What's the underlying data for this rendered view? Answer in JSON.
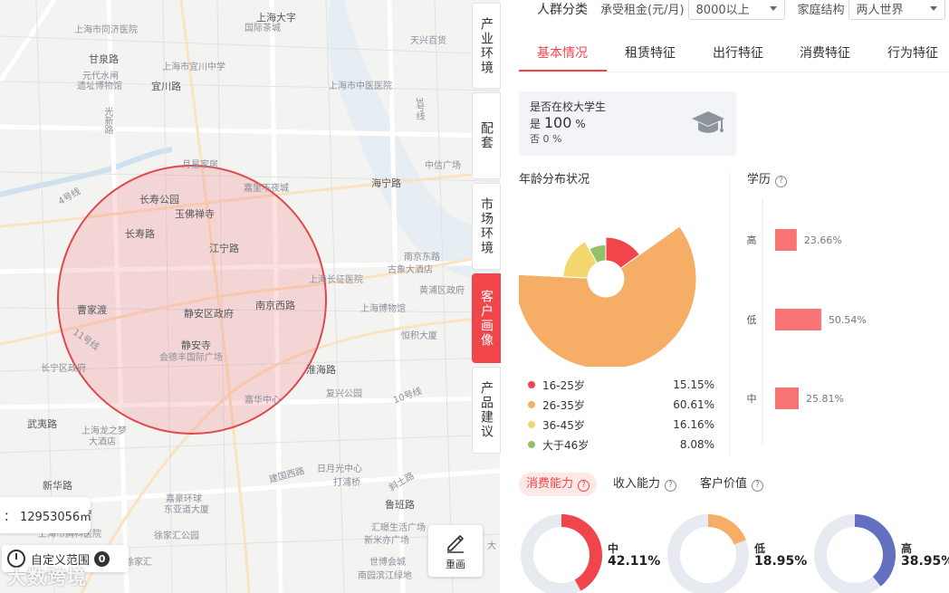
{
  "map": {
    "labels": [
      {
        "text": "上海大字",
        "cls": "dark"
      },
      {
        "text": "国际茶城",
        "cls": ""
      },
      {
        "text": "上海市同济医院",
        "cls": ""
      },
      {
        "text": "天兴百货",
        "cls": ""
      },
      {
        "text": "甘泉路",
        "cls": "dark"
      },
      {
        "text": "上海市宜川中学",
        "cls": ""
      },
      {
        "text": "元代水闸",
        "cls": ""
      },
      {
        "text": "遗址博物馆",
        "cls": ""
      },
      {
        "text": "宜川路",
        "cls": "dark"
      },
      {
        "text": "上海市中医医院",
        "cls": ""
      },
      {
        "text": "光新路",
        "cls": ""
      },
      {
        "text": "3号线",
        "cls": ""
      },
      {
        "text": "中信广场",
        "cls": ""
      },
      {
        "text": "月星家居",
        "cls": ""
      },
      {
        "text": "嘉里不夜城",
        "cls": ""
      },
      {
        "text": "海宁路",
        "cls": "dark"
      },
      {
        "text": "4号线",
        "cls": ""
      },
      {
        "text": "长寿公园",
        "cls": "dark"
      },
      {
        "text": "玉佛禅寺",
        "cls": "dark"
      },
      {
        "text": "长寿路",
        "cls": "dark"
      },
      {
        "text": "江宁路",
        "cls": "dark"
      },
      {
        "text": "南京东路",
        "cls": ""
      },
      {
        "text": "古象大酒店",
        "cls": ""
      },
      {
        "text": "上海长征医院",
        "cls": ""
      },
      {
        "text": "黄浦区政府",
        "cls": ""
      },
      {
        "text": "曹家渡",
        "cls": "dark"
      },
      {
        "text": "静安区政府",
        "cls": "dark"
      },
      {
        "text": "南京西路",
        "cls": "dark"
      },
      {
        "text": "上海博物馆",
        "cls": ""
      },
      {
        "text": "11号线",
        "cls": ""
      },
      {
        "text": "静安寺",
        "cls": "dark"
      },
      {
        "text": "会德丰国际广场",
        "cls": ""
      },
      {
        "text": "恒积大厦",
        "cls": ""
      },
      {
        "text": "长宁区政府",
        "cls": ""
      },
      {
        "text": "淮海路",
        "cls": "dark"
      },
      {
        "text": "复兴公园",
        "cls": ""
      },
      {
        "text": "10号线",
        "cls": ""
      },
      {
        "text": "嘉华中心",
        "cls": ""
      },
      {
        "text": "武夷路",
        "cls": "dark"
      },
      {
        "text": "上海龙之梦",
        "cls": ""
      },
      {
        "text": "大酒店",
        "cls": ""
      },
      {
        "text": "建国西路",
        "cls": ""
      },
      {
        "text": "日月光中心",
        "cls": ""
      },
      {
        "text": "打浦桥",
        "cls": ""
      },
      {
        "text": "斜土路",
        "cls": ""
      },
      {
        "text": "新华路",
        "cls": "dark"
      },
      {
        "text": "嘉豪环球",
        "cls": ""
      },
      {
        "text": "东亚道大厦",
        "cls": ""
      },
      {
        "text": "鲁班路",
        "cls": "dark"
      },
      {
        "text": "汇暻生活广场",
        "cls": ""
      },
      {
        "text": "新米亦广场",
        "cls": ""
      },
      {
        "text": "徐家汇公园",
        "cls": ""
      },
      {
        "text": "上海市胸科医院",
        "cls": ""
      },
      {
        "text": "徐家汇",
        "cls": ""
      },
      {
        "text": "世博会城",
        "cls": ""
      },
      {
        "text": "南园滨江绿地",
        "cls": ""
      },
      {
        "text": "大",
        "cls": ""
      }
    ],
    "area_prefix": "：",
    "area_value": "12953056㎡",
    "custom_range_label": "自定义范围",
    "custom_range_count": "0",
    "watermark": "大数跨境",
    "redraw_label": "重画"
  },
  "vtabs": [
    {
      "label": "产业环境",
      "active": false
    },
    {
      "label": "配套",
      "active": false
    },
    {
      "label": "市场环境",
      "active": false
    },
    {
      "label": "客户画像",
      "active": true
    },
    {
      "label": "产品建议",
      "active": false
    }
  ],
  "filters": {
    "title": "人群分类",
    "rent_label": "承受租金(元/月)",
    "rent_value": "8000以上",
    "family_label": "家庭结构",
    "family_value": "两人世界"
  },
  "tabs": [
    "基本情况",
    "租赁特征",
    "出行特征",
    "消费特征",
    "行为特征"
  ],
  "student": {
    "title": "是否在校大学生",
    "yes_label": "是",
    "yes_value": "100",
    "yes_unit": "%",
    "no_text": "否 0 %"
  },
  "age_title": "年龄分布状况",
  "edu_title": "学历",
  "chart_data": [
    {
      "type": "pie",
      "title": "年龄分布状况",
      "categories": [
        "16-25岁",
        "26-35岁",
        "36-45岁",
        "大于46岁"
      ],
      "values": [
        15.15,
        60.61,
        16.16,
        8.08
      ],
      "value_labels": [
        "15.15%",
        "60.61%",
        "16.16%",
        "8.08%"
      ],
      "colors": [
        "#f0454b",
        "#f6ad66",
        "#f3d66e",
        "#93c166"
      ],
      "style": "rose"
    },
    {
      "type": "bar",
      "orientation": "horizontal",
      "title": "学历",
      "categories": [
        "高",
        "低",
        "中"
      ],
      "values": [
        23.66,
        50.54,
        25.81
      ],
      "value_labels": [
        "23.66%",
        "50.54%",
        "25.81%"
      ],
      "color": "#f87474"
    },
    {
      "type": "pie",
      "style": "donut",
      "categories": [
        "中",
        "低",
        "高"
      ],
      "values": [
        42.11,
        18.95,
        38.95
      ],
      "value_labels": [
        "42.11%",
        "18.95%",
        "38.95%"
      ],
      "colors": [
        "#f0454b",
        "#f6ad66",
        "#6370bf"
      ],
      "track_color": "#e7ebf1"
    }
  ],
  "sub_tabs": [
    {
      "label": "消费能力",
      "active": true
    },
    {
      "label": "收入能力",
      "active": false
    },
    {
      "label": "客户价值",
      "active": false
    }
  ]
}
